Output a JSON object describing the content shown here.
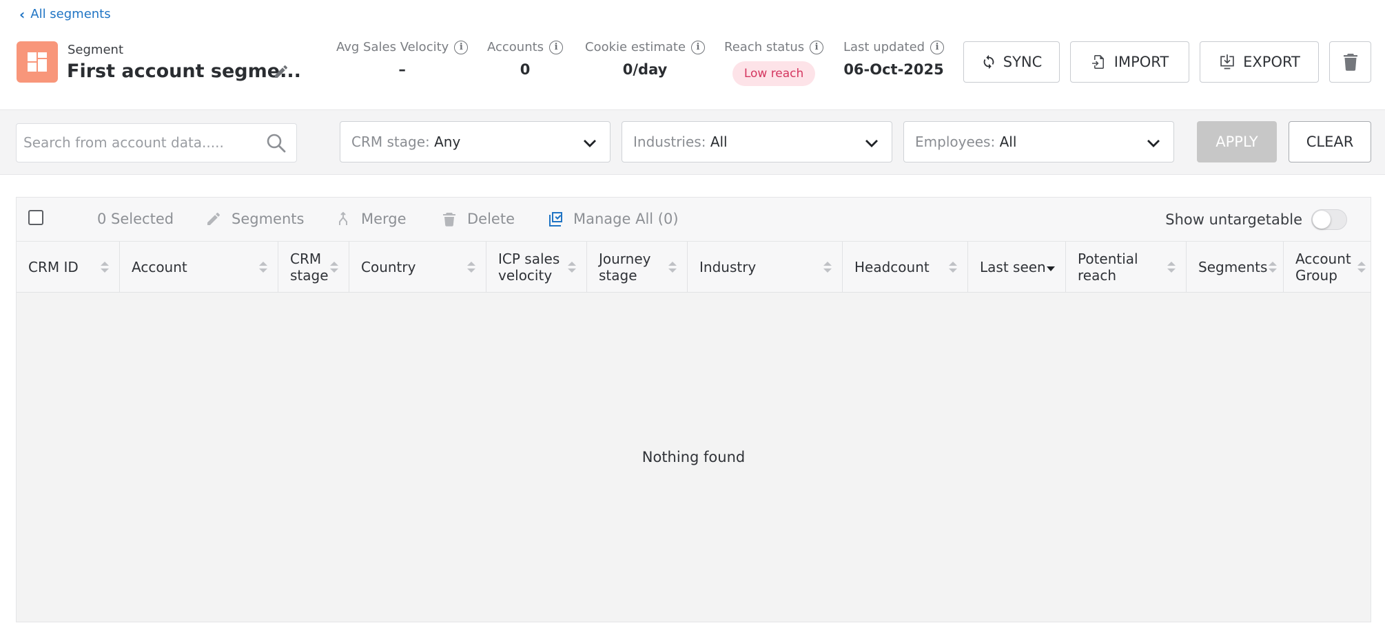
{
  "nav": {
    "back_label": "All segments"
  },
  "segment": {
    "label": "Segment",
    "name": "First account segme..."
  },
  "stats": {
    "avg_sales_velocity": {
      "label": "Avg Sales Velocity",
      "value": "–"
    },
    "accounts": {
      "label": "Accounts",
      "value": "0"
    },
    "cookie_estimate": {
      "label": "Cookie estimate",
      "value": "0/day"
    },
    "reach_status": {
      "label": "Reach status",
      "value": "Low reach"
    },
    "last_updated": {
      "label": "Last updated",
      "value": "06-Oct-2025"
    }
  },
  "actions": {
    "sync": "SYNC",
    "import": "IMPORT",
    "export": "EXPORT"
  },
  "filters": {
    "search_placeholder": "Search from account data.....",
    "crm_stage": {
      "label": "CRM stage: ",
      "value": "Any"
    },
    "industries": {
      "label": "Industries: ",
      "value": "All"
    },
    "employees": {
      "label": "Employees: ",
      "value": "All"
    },
    "apply": "APPLY",
    "clear": "CLEAR"
  },
  "toolbar": {
    "selected": "0 Selected",
    "segments": "Segments",
    "merge": "Merge",
    "delete": "Delete",
    "manage_all": "Manage All (0)",
    "show_untargetable": "Show untargetable"
  },
  "columns": [
    {
      "l1": "CRM ID",
      "l2": ""
    },
    {
      "l1": "Account",
      "l2": ""
    },
    {
      "l1": "CRM",
      "l2": "stage"
    },
    {
      "l1": "Country",
      "l2": ""
    },
    {
      "l1": "ICP sales",
      "l2": "velocity"
    },
    {
      "l1": "Journey",
      "l2": "stage"
    },
    {
      "l1": "Industry",
      "l2": ""
    },
    {
      "l1": "Headcount",
      "l2": ""
    },
    {
      "l1": "Last seen",
      "l2": ""
    },
    {
      "l1": "Potential",
      "l2": "reach"
    },
    {
      "l1": "Segments",
      "l2": ""
    },
    {
      "l1": "Account",
      "l2": "Group"
    }
  ],
  "empty_message": "Nothing found",
  "colors": {
    "accent": "#1f74c4",
    "segment_icon": "#f8967a",
    "badge_bg": "#fde3e8",
    "badge_text": "#d4365f",
    "manage_icon": "#1f74c4"
  }
}
